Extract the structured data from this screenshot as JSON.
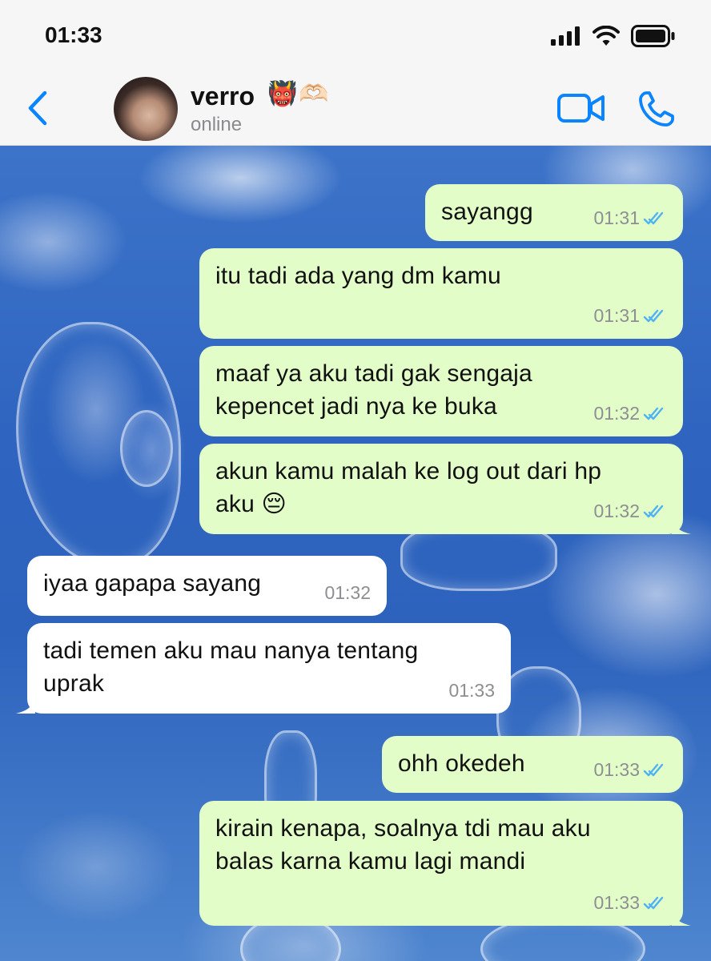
{
  "status_bar": {
    "time": "01:33"
  },
  "header": {
    "contact_name": "verro",
    "contact_emoji": [
      "👹",
      "🫶🏻"
    ],
    "status": "online"
  },
  "messages": [
    {
      "direction": "outgoing",
      "text": "sayangg",
      "time": "01:31",
      "read": true
    },
    {
      "direction": "outgoing",
      "text": "itu tadi ada yang dm kamu",
      "time": "01:31",
      "read": true
    },
    {
      "direction": "outgoing",
      "text": "maaf ya aku tadi gak sengaja\nkepencet jadi nya ke buka",
      "time": "01:32",
      "read": true
    },
    {
      "direction": "outgoing",
      "text": "akun kamu malah ke log out dari hp\naku 😔",
      "time": "01:32",
      "read": true
    },
    {
      "direction": "incoming",
      "text": "iyaa gapapa sayang",
      "time": "01:32"
    },
    {
      "direction": "incoming",
      "text": "tadi temen aku mau nanya tentang\nuprak",
      "time": "01:33"
    },
    {
      "direction": "outgoing",
      "text": "ohh okedeh",
      "time": "01:33",
      "read": true
    },
    {
      "direction": "outgoing",
      "text": "kirain kenapa, soalnya tdi mau aku\nbalas karna kamu lagi mandi",
      "time": "01:33",
      "read": true
    }
  ],
  "colors": {
    "accent": "#0a84ff",
    "outgoing_bubble": "#e2fdc8",
    "incoming_bubble": "#ffffff",
    "read_ticks": "#4fb2f2"
  }
}
